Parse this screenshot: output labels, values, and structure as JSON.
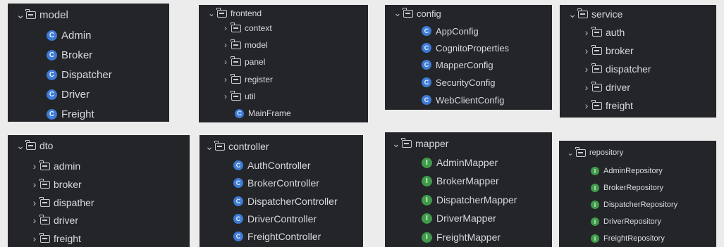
{
  "colors": {
    "panel_bg": "#232528",
    "class_icon": "#3d7bd6",
    "interface_icon": "#3f9a49",
    "page_bg": "#ececec"
  },
  "icons": {
    "collapse": "chevron-down-icon",
    "expand": "chevron-right-icon",
    "folder": "folder-icon",
    "class": "class-icon",
    "interface": "interface-icon"
  },
  "panels": {
    "model": {
      "root": "model",
      "items": [
        "Admin",
        "Broker",
        "Dispatcher",
        "Driver",
        "Freight"
      ]
    },
    "frontend": {
      "root": "frontend",
      "folders": [
        "context",
        "model",
        "panel",
        "register",
        "util"
      ],
      "classes": [
        "MainFrame"
      ]
    },
    "config": {
      "root": "config",
      "items": [
        "AppConfig",
        "CognitoProperties",
        "MapperConfig",
        "SecurityConfig",
        "WebClientConfig"
      ]
    },
    "service": {
      "root": "service",
      "folders": [
        "auth",
        "broker",
        "dispatcher",
        "driver",
        "freight"
      ]
    },
    "dto": {
      "root": "dto",
      "folders": [
        "admin",
        "broker",
        "dispather",
        "driver",
        "freight"
      ]
    },
    "controller": {
      "root": "controller",
      "items": [
        "AuthController",
        "BrokerController",
        "DispatcherController",
        "DriverController",
        "FreightController"
      ]
    },
    "mapper": {
      "root": "mapper",
      "items": [
        "AdminMapper",
        "BrokerMapper",
        "DispatcherMapper",
        "DriverMapper",
        "FreightMapper"
      ]
    },
    "repository": {
      "root": "repository",
      "items": [
        "AdminRepository",
        "BrokerRepository",
        "DispatcherRepository",
        "DriverRepository",
        "FreightRepository"
      ]
    }
  }
}
